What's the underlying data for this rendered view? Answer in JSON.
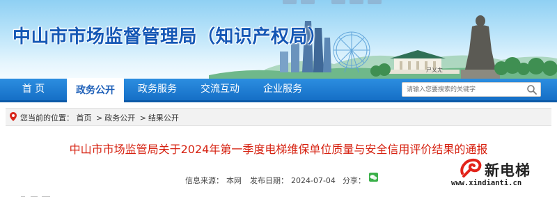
{
  "header": {
    "site_title": "中山市市场监督管理局（知识产权局）"
  },
  "nav": {
    "items": [
      {
        "label": "首  页"
      },
      {
        "label": "政务公开"
      },
      {
        "label": "政务服务"
      },
      {
        "label": "交流互动"
      },
      {
        "label": "企业服务"
      }
    ],
    "active_index": 1,
    "search_placeholder": "请输入您要搜索的关键字"
  },
  "breadcrumb": {
    "prefix": "您当前的位置：",
    "items": [
      "首页",
      "政务公开",
      "结果公开"
    ],
    "separator": ">"
  },
  "article": {
    "title": "中山市市场监管局关于2024年第一季度电梯维保单位质量与安全信用评价结果的通报",
    "source_label": "信息来源：",
    "source_value": "本网",
    "date_label": "发布日期：",
    "date_value": "2024-07-04",
    "share_label": "分享："
  },
  "watermark": {
    "name": "新电梯",
    "url": "www.xindianti.cn"
  },
  "colors": {
    "nav_bg": "#1a78d0",
    "title_blue": "#1457b5",
    "article_title_red": "#d6200f",
    "watermark_red": "#e2231a"
  }
}
